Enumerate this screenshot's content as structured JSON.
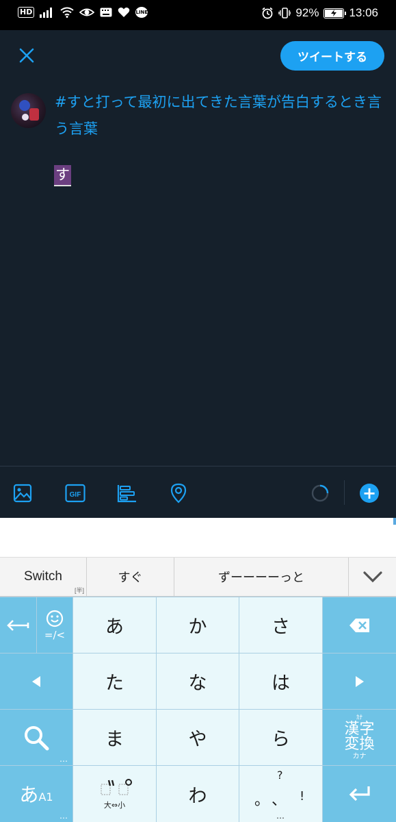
{
  "status_bar": {
    "hd": "HD",
    "line_label": "LINE",
    "battery": "92%",
    "battery_level": 0.92,
    "time": "13:06"
  },
  "compose": {
    "tweet_button": "ツイートする",
    "text": "#すと打って最初に出てきた言葉が告白するとき言う言葉",
    "composing": "す"
  },
  "toolbar": {
    "icons": [
      "image-icon",
      "gif-icon",
      "poll-icon",
      "location-icon",
      "character-count-icon",
      "add-tweet-icon"
    ],
    "gif_label": "GIF",
    "plus": "+"
  },
  "candidates": {
    "switch": "Switch",
    "switch_sub": "[半]",
    "items": [
      "すぐ",
      "ずーーーーっと"
    ]
  },
  "keyboard": {
    "main": [
      "あ",
      "か",
      "さ",
      "た",
      "な",
      "は",
      "ま",
      "や",
      "ら",
      "わ"
    ],
    "emoji_sub": "=/<",
    "kanji_top": "漢字",
    "kanji_bottom": "変換",
    "kanji_ruby_top": "ｶﾅ",
    "kanji_ruby_bottom": "カナ",
    "mode_main": "あ",
    "mode_sub": "A1",
    "dakuten_label": "大⇔小",
    "punct_q": "?",
    "punct_ex": "!",
    "punct_marks": "。、",
    "ellipsis": "…"
  },
  "colors": {
    "background": "#15202b",
    "accent": "#1da1f2",
    "key_side": "#6fc3e6",
    "key_main": "#e9f8fb",
    "composing_bg": "#6b3f80"
  }
}
